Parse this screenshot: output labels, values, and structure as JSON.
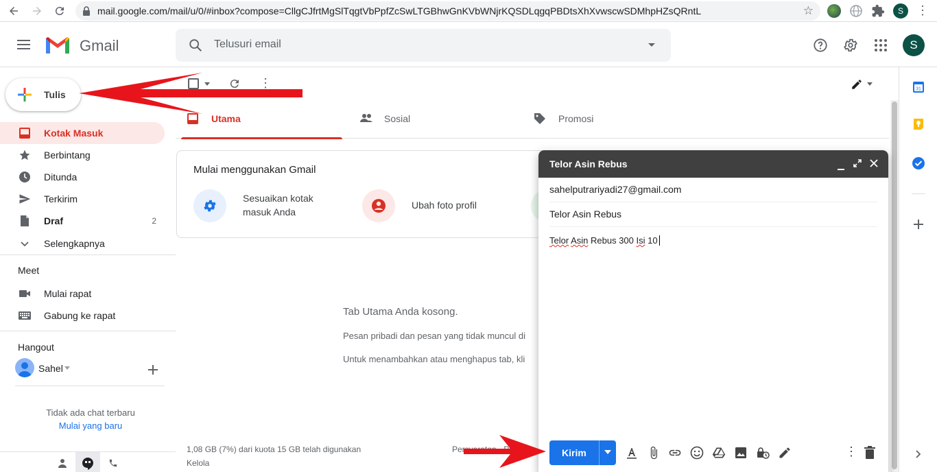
{
  "browser": {
    "url": "mail.google.com/mail/u/0/#inbox?compose=CllgCJfrtMgSlTqgtVbPpfZcSwLTGBhwGnKVbWNjrKQSDLqgqPBDtsXhXvwscwSDMhpHZsQRntL",
    "profile_initial": "S"
  },
  "header": {
    "app_name": "Gmail",
    "search_placeholder": "Telusuri email",
    "avatar_initial": "S"
  },
  "sidebar": {
    "compose_label": "Tulis",
    "items": [
      {
        "label": "Kotak Masuk",
        "count": ""
      },
      {
        "label": "Berbintang",
        "count": ""
      },
      {
        "label": "Ditunda",
        "count": ""
      },
      {
        "label": "Terkirim",
        "count": ""
      },
      {
        "label": "Draf",
        "count": "2"
      },
      {
        "label": "Selengkapnya",
        "count": ""
      }
    ],
    "meet_title": "Meet",
    "meet_items": [
      "Mulai rapat",
      "Gabung ke rapat"
    ],
    "hangout_title": "Hangout",
    "hangout_user": "Sahel",
    "no_chat": "Tidak ada chat terbaru",
    "start_new": "Mulai yang baru"
  },
  "tabs": [
    {
      "label": "Utama"
    },
    {
      "label": "Sosial"
    },
    {
      "label": "Promosi"
    }
  ],
  "onboarding": {
    "title": "Mulai menggunakan Gmail",
    "item1_line1": "Sesuaikan kotak",
    "item1_line2": "masuk Anda",
    "item2": "Ubah foto profil"
  },
  "empty": {
    "title": "Tab Utama Anda kosong.",
    "line1": "Pesan pribadi dan pesan yang tidak muncul di",
    "line2": "Untuk menambahkan atau menghapus tab, kli"
  },
  "footer": {
    "storage": "1,08 GB (7%) dari kuota 15 GB telah digunakan",
    "manage": "Kelola",
    "links": "Persyaratan · Priv"
  },
  "compose": {
    "title": "Telor Asin Rebus",
    "to": "sahelputrariyadi27@gmail.com",
    "subject": "Telor Asin Rebus",
    "body_w1": "Telor",
    "body_w2": "Asin",
    "body_w3": "Rebus 300",
    "body_w4": "Isi",
    "body_w5": "10",
    "send_label": "Kirim"
  },
  "colors": {
    "accent_red": "#d93025",
    "send_blue": "#1a73e8",
    "compose_header": "#404040",
    "annotation_arrow": "#e8141b"
  }
}
